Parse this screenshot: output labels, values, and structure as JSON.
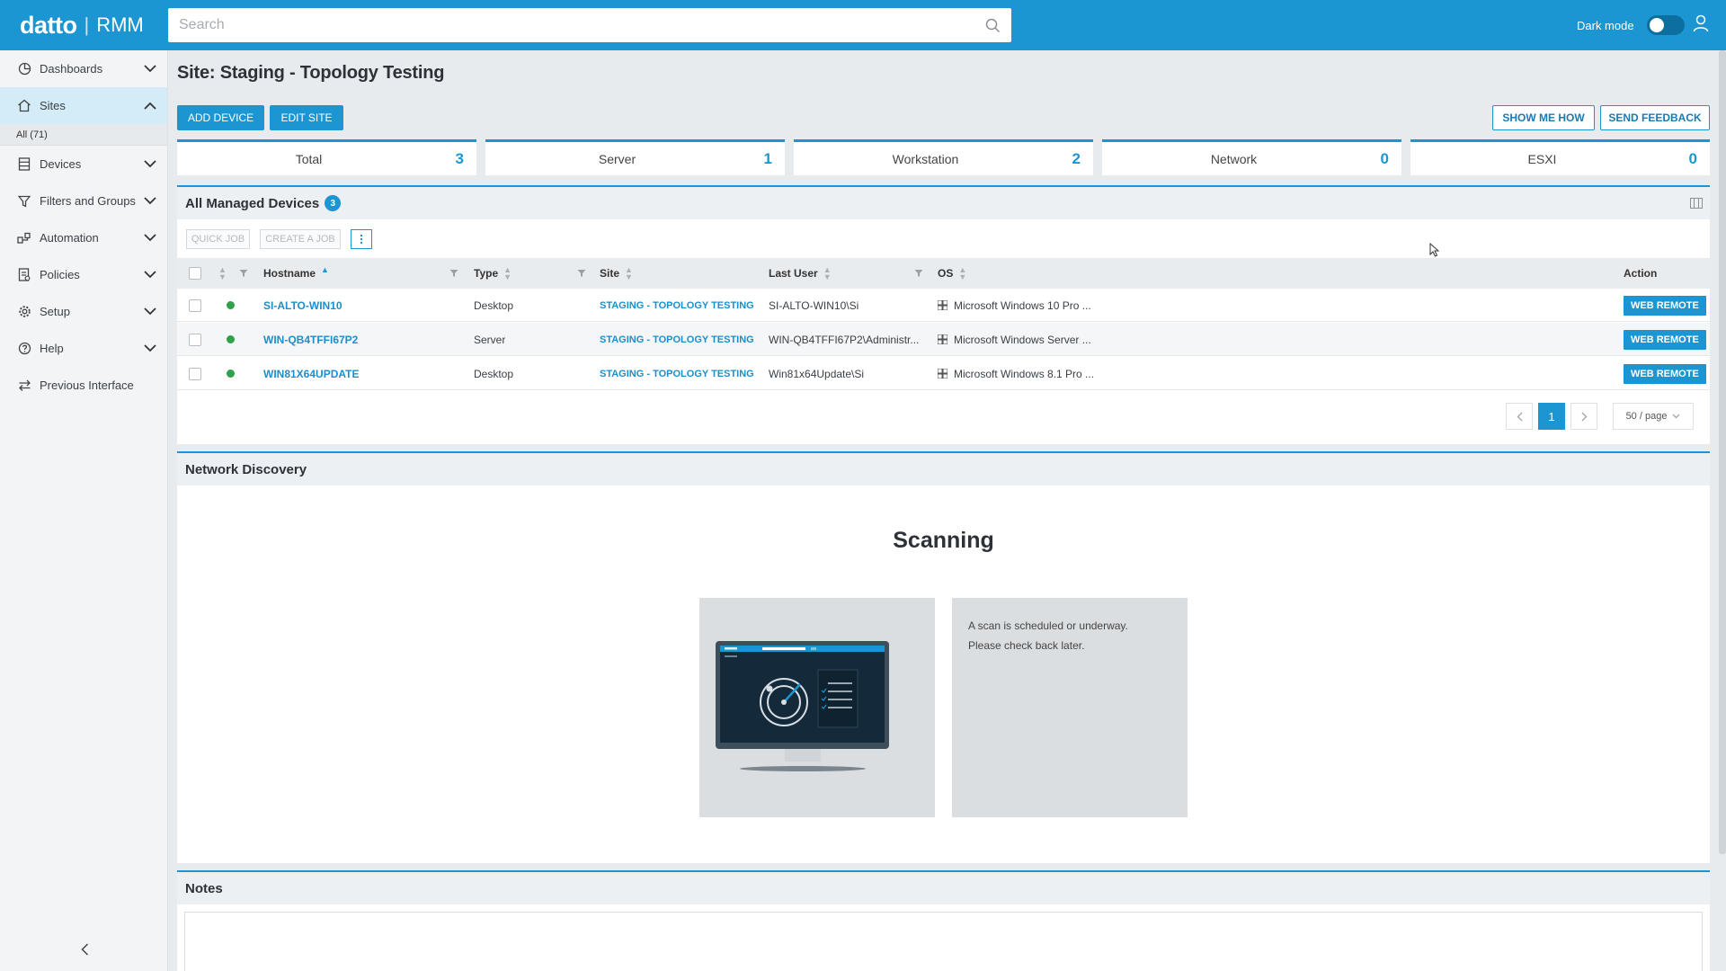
{
  "app": {
    "brand": "datto",
    "product": "RMM"
  },
  "search": {
    "placeholder": "Search"
  },
  "header": {
    "dark_mode_label": "Dark mode"
  },
  "sidebar": {
    "items": [
      {
        "label": "Dashboards",
        "icon": "dashboard-icon"
      },
      {
        "label": "Sites",
        "icon": "home-icon"
      },
      {
        "label": "Devices",
        "icon": "devices-icon"
      },
      {
        "label": "Filters and Groups",
        "icon": "filter-icon"
      },
      {
        "label": "Automation",
        "icon": "automation-icon"
      },
      {
        "label": "Policies",
        "icon": "policies-icon"
      },
      {
        "label": "Setup",
        "icon": "gear-icon"
      },
      {
        "label": "Help",
        "icon": "help-icon"
      },
      {
        "label": "Previous Interface",
        "icon": "swap-icon"
      }
    ],
    "sites_sub": "All (71)"
  },
  "page": {
    "title": "Site: Staging - Topology Testing"
  },
  "actions": {
    "add_device": "ADD DEVICE",
    "edit_site": "EDIT SITE",
    "show_me_how": "SHOW ME HOW",
    "send_feedback": "SEND FEEDBACK"
  },
  "stats": [
    {
      "label": "Total",
      "value": "3"
    },
    {
      "label": "Server",
      "value": "1"
    },
    {
      "label": "Workstation",
      "value": "2"
    },
    {
      "label": "Network",
      "value": "0"
    },
    {
      "label": "ESXI",
      "value": "0"
    }
  ],
  "devices": {
    "title": "All Managed Devices",
    "count": "3",
    "quick_job": "QUICK JOB",
    "create_job": "CREATE A JOB",
    "columns": {
      "hostname": "Hostname",
      "type": "Type",
      "site": "Site",
      "last_user": "Last User",
      "os": "OS",
      "action": "Action"
    },
    "rows": [
      {
        "hostname": "SI-ALTO-WIN10",
        "type": "Desktop",
        "site": "STAGING - TOPOLOGY TESTING",
        "last_user": "SI-ALTO-WIN10\\Si",
        "os": "Microsoft Windows 10 Pro ...",
        "action": "WEB REMOTE"
      },
      {
        "hostname": "WIN-QB4TFFI67P2",
        "type": "Server",
        "site": "STAGING - TOPOLOGY TESTING",
        "last_user": "WIN-QB4TFFI67P2\\Administr...",
        "os": "Microsoft Windows Server ...",
        "action": "WEB REMOTE"
      },
      {
        "hostname": "WIN81X64UPDATE",
        "type": "Desktop",
        "site": "STAGING - TOPOLOGY TESTING",
        "last_user": "Win81x64Update\\Si",
        "os": "Microsoft Windows 8.1 Pro ...",
        "action": "WEB REMOTE"
      }
    ],
    "pagination": {
      "current": "1",
      "page_size": "50 / page"
    }
  },
  "network_discovery": {
    "title": "Network Discovery",
    "status": "Scanning",
    "message_line1": "A scan is scheduled or underway.",
    "message_line2": "Please check back later."
  },
  "notes": {
    "title": "Notes"
  },
  "colors": {
    "accent": "#1b96d2",
    "online": "#2ea24a",
    "sidebar_active": "#d4ecf8"
  }
}
